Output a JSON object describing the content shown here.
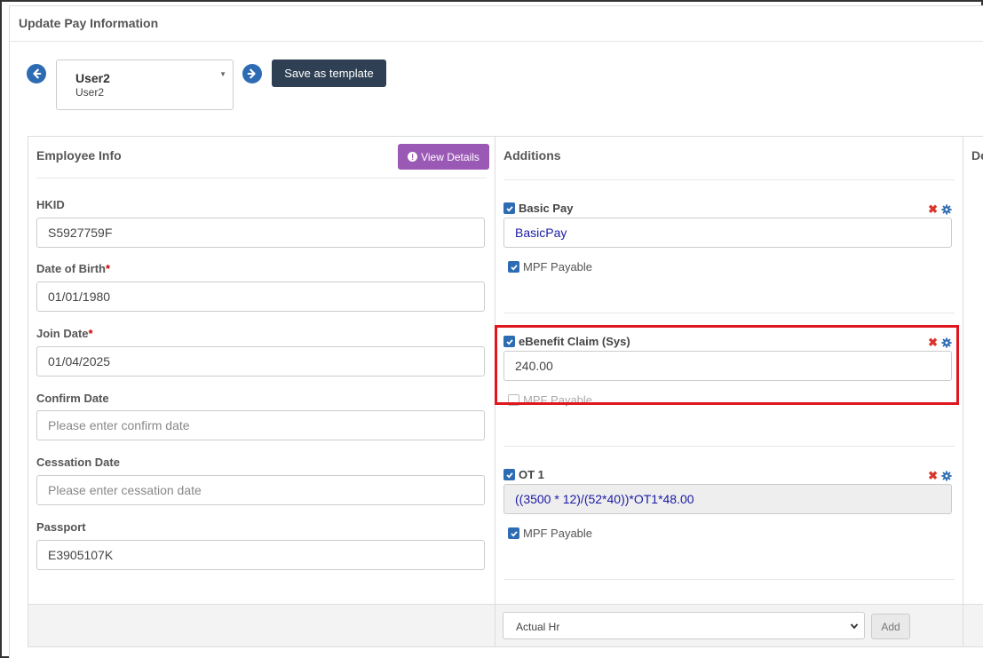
{
  "page": {
    "title": "Update Pay Information"
  },
  "user_select": {
    "name": "User2",
    "sub": "User2"
  },
  "toolbar": {
    "save_template_label": "Save as template"
  },
  "employee_info": {
    "title": "Employee Info",
    "view_details_label": "View Details",
    "fields": {
      "hkid": {
        "label": "HKID",
        "value": "S5927759F"
      },
      "dob": {
        "label": "Date of Birth",
        "required": "*",
        "value": "01/01/1980"
      },
      "join": {
        "label": "Join Date",
        "required": "*",
        "value": "01/04/2025"
      },
      "confirm": {
        "label": "Confirm Date",
        "placeholder": "Please enter confirm date"
      },
      "cessation": {
        "label": "Cessation Date",
        "placeholder": "Please enter cessation date"
      },
      "passport": {
        "label": "Passport",
        "value": "E3905107K"
      }
    }
  },
  "additions": {
    "title": "Additions",
    "items": [
      {
        "label": "Basic Pay",
        "value": "BasicPay",
        "mpf_label": "MPF Payable",
        "mpf_checked": true
      },
      {
        "label": "eBenefit Claim (Sys)",
        "value": "240.00",
        "mpf_label": "MPF Payable",
        "mpf_checked": false
      },
      {
        "label": "OT 1",
        "value": "((3500 * 12)/(52*40))*OT1*48.00",
        "mpf_label": "MPF Payable",
        "mpf_checked": true
      }
    ],
    "footer": {
      "select_value": "Actual Hr",
      "add_label": "Add"
    }
  },
  "deductions": {
    "title": "Deductions"
  },
  "colors": {
    "accent": "#2d6bb3",
    "purple": "#9b59b6",
    "dark_button": "#2f4054",
    "highlight": "#e0161f"
  }
}
